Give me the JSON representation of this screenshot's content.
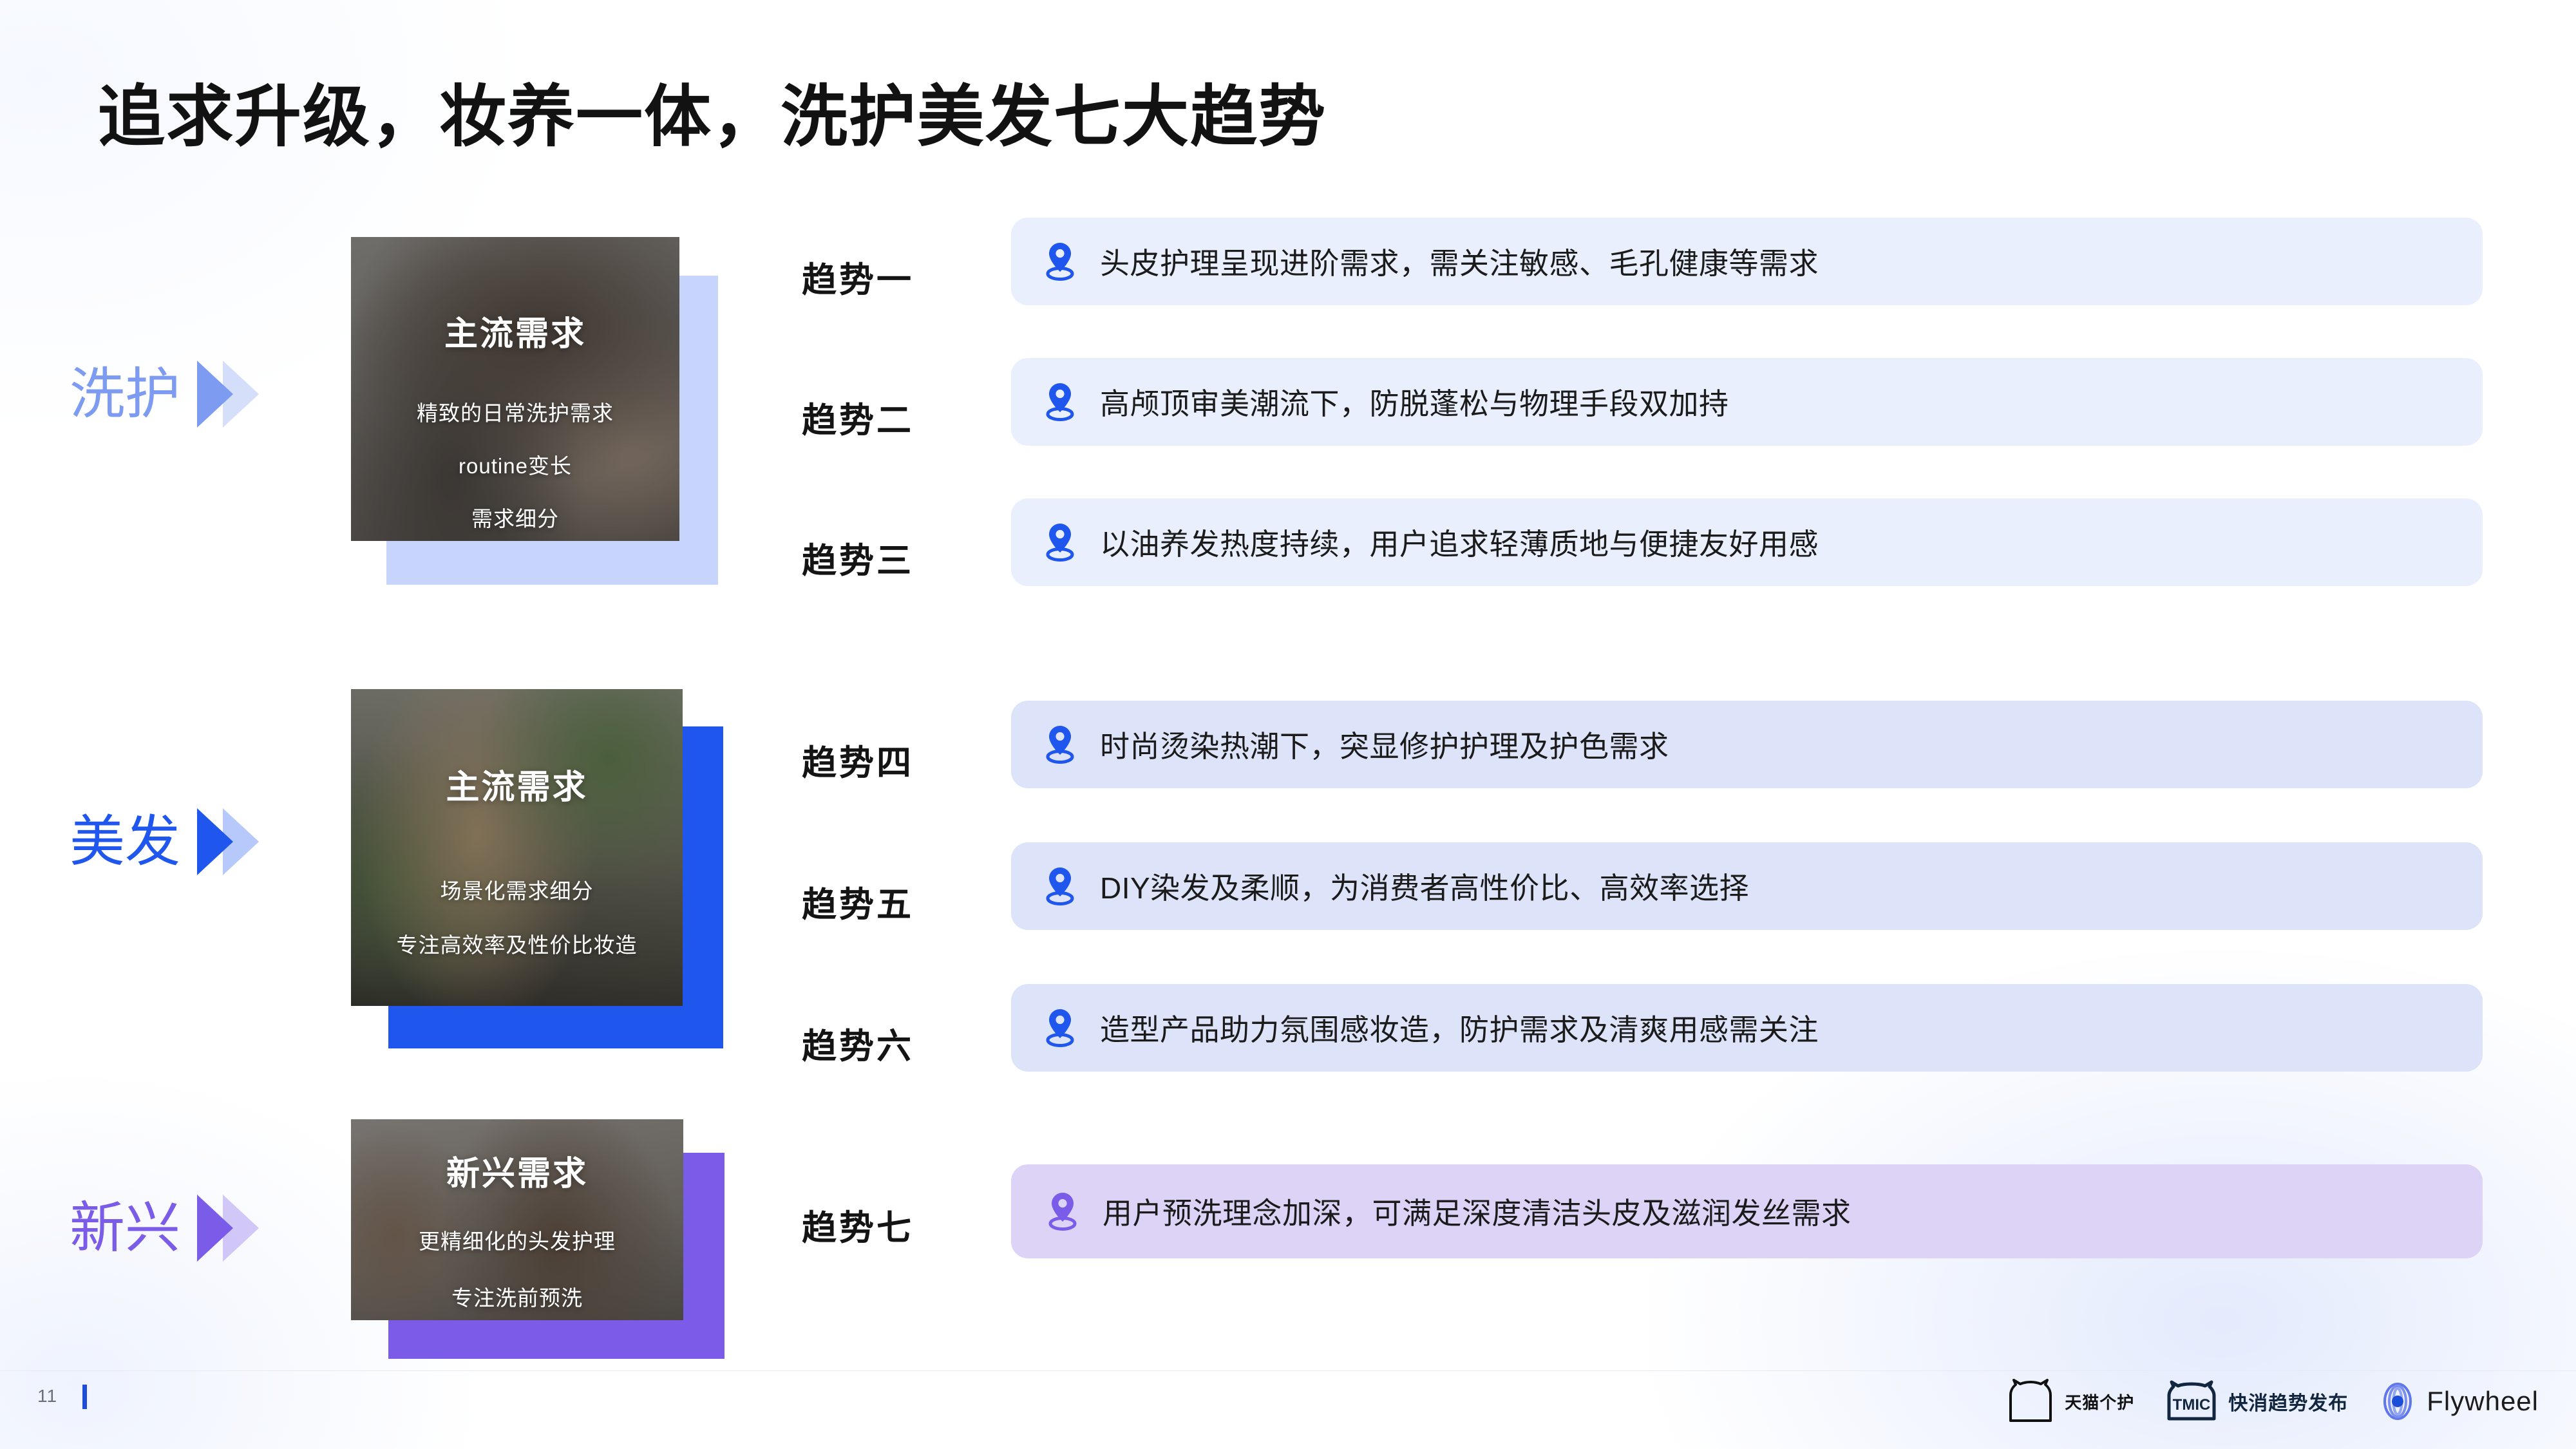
{
  "slide": {
    "title": "追求升级，妆养一体，洗护美发七大趋势",
    "page_number": "11"
  },
  "colors": {
    "category_wash": "#7d9bf0",
    "category_hair": "#1f56ee",
    "category_new": "#7b5ce8",
    "pill_blue_light": "#e9effc",
    "pill_blue_mid": "#dde3f8",
    "pill_purple": "#ddd3f7",
    "pin_blue": "#1f56ee",
    "pin_purple": "#7b5ce8",
    "title_black": "#121212",
    "page_accent": "#1d4ed8"
  },
  "categories": [
    {
      "label": "洗护",
      "color": "#7d9bf0",
      "arrow_icon": "double-chevron-right-icon"
    },
    {
      "label": "美发",
      "color": "#1f56ee",
      "arrow_icon": "double-chevron-right-icon"
    },
    {
      "label": "新兴",
      "color": "#7b5ce8",
      "arrow_icon": "double-chevron-right-icon"
    }
  ],
  "cards": [
    {
      "title": "主流需求",
      "lines": [
        "精致的日常洗护需求",
        "routine变长",
        "需求细分"
      ],
      "frame_color": "#c7d4fb",
      "alt": "woman washing wet hair photo"
    },
    {
      "title": "主流需求",
      "lines": [
        "场景化需求细分",
        "专注高效率及性价比妆造"
      ],
      "frame_color": "#1f56ee",
      "alt": "woman with long wavy hair among plants photo"
    },
    {
      "title": "新兴需求",
      "lines": [
        "更精细化的头发护理",
        "专注洗前预洗"
      ],
      "frame_color": "#7b5ce8",
      "alt": "woman with curly ponytail in bathroom photo"
    }
  ],
  "trends": [
    {
      "no": "趋势一",
      "text": "头皮护理呈现进阶需求，需关注敏感、毛孔健康等需求",
      "pill_bg": "#e9effc",
      "pin_color": "#1f56ee",
      "pin_icon": "location-pin-icon"
    },
    {
      "no": "趋势二",
      "text": "高颅顶审美潮流下，防脱蓬松与物理手段双加持",
      "pill_bg": "#e9effc",
      "pin_color": "#1f56ee",
      "pin_icon": "location-pin-icon"
    },
    {
      "no": "趋势三",
      "text": "以油养发热度持续，用户追求轻薄质地与便捷友好用感",
      "pill_bg": "#e9effc",
      "pin_color": "#1f56ee",
      "pin_icon": "location-pin-icon"
    },
    {
      "no": "趋势四",
      "text": "时尚烫染热潮下，突显修护护理及护色需求",
      "pill_bg": "#dde3f8",
      "pin_color": "#1f56ee",
      "pin_icon": "location-pin-icon"
    },
    {
      "no": "趋势五",
      "text": "DIY染发及柔顺，为消费者高性价比、高效率选择",
      "pill_bg": "#dde3f8",
      "pin_color": "#1f56ee",
      "pin_icon": "location-pin-icon"
    },
    {
      "no": "趋势六",
      "text": "造型产品助力氛围感妆造，防护需求及清爽用感需关注",
      "pill_bg": "#dde3f8",
      "pin_color": "#1f56ee",
      "pin_icon": "location-pin-icon"
    },
    {
      "no": "趋势七",
      "text": "用户预洗理念加深，可满足深度清洁头皮及滋润发丝需求",
      "pill_bg": "#ddd3f7",
      "pin_color": "#7b5ce8",
      "pin_icon": "location-pin-icon"
    }
  ],
  "footer": {
    "logos": [
      {
        "name": "tmall-personal-care-logo",
        "text": "天猫个护",
        "icon": "cat-outline-icon"
      },
      {
        "name": "tmic-logo",
        "badge": "TMIC",
        "text": "快消趋势发布",
        "icon": "cat-badge-icon"
      },
      {
        "name": "flywheel-logo",
        "text": "Flywheel",
        "icon": "flywheel-spiral-icon"
      }
    ]
  }
}
